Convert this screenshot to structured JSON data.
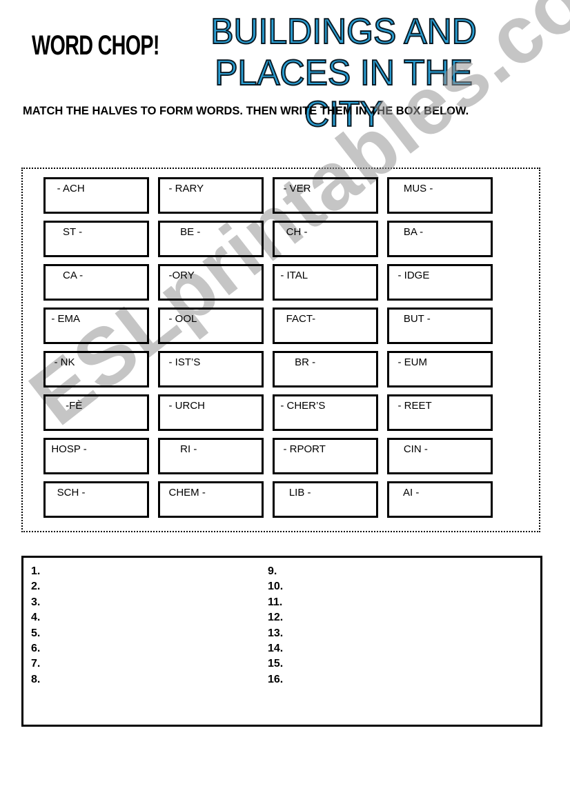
{
  "header": {
    "badge": "WORD CHOP!",
    "title_line1": "BUILDINGS AND",
    "title_line2": "PLACES IN THE CITY"
  },
  "instructions": "MATCH THE HALVES TO FORM WORDS. THEN WRITE THEM IN THE BOX BELOW.",
  "colors": {
    "title_fill": "#2a9fd4",
    "title_outline": "#0a1a24",
    "watermark": "#969696"
  },
  "chop_cards": [
    [
      "    - ACH",
      "   - RARY",
      "   - VER",
      "     MUS -"
    ],
    [
      "      ST -",
      "       BE -",
      "    CH -",
      "     BA -"
    ],
    [
      "      CA -",
      "   -ORY",
      "  - ITAL",
      "   - IDGE"
    ],
    [
      "  - EMA",
      "   - OOL",
      "    FACT-",
      "     BUT -"
    ],
    [
      "   - NK",
      "   - IST’S",
      "       BR -",
      "   - EUM"
    ],
    [
      "       -FÈ",
      "   - URCH",
      "  - CHER’S",
      "   - REET"
    ],
    [
      "  HOSP -",
      "       RI -",
      "   - RPORT",
      "     CIN -"
    ],
    [
      "    SCH -",
      "   CHEM -",
      "     LIB -",
      "     AI -"
    ]
  ],
  "answers": {
    "left": [
      "1.",
      "2.",
      "3.",
      "4.",
      "5.",
      "6.",
      "7.",
      "8."
    ],
    "right": [
      "9.",
      "10.",
      "11.",
      "12.",
      "13.",
      "14.",
      "15.",
      "16."
    ]
  },
  "watermark": "ESLprintables.com"
}
